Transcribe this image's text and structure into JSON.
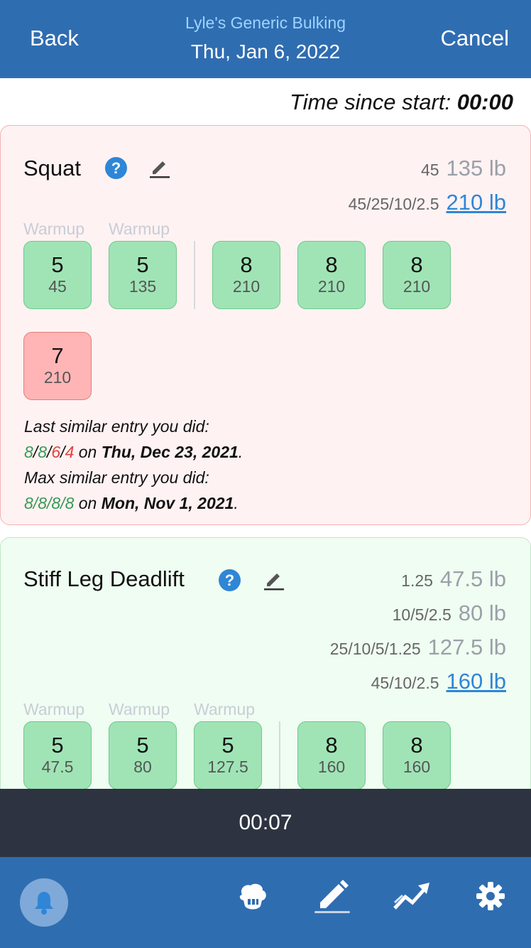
{
  "header": {
    "back_label": "Back",
    "cancel_label": "Cancel",
    "program_name": "Lyle's Generic Bulking",
    "date": "Thu, Jan 6, 2022"
  },
  "timer": {
    "label": "Time since start:",
    "value": "00:00"
  },
  "exercises": [
    {
      "name": "Squat",
      "plates": [
        {
          "plates": "45",
          "weight": "135 lb",
          "is_link": false
        },
        {
          "plates": "45/25/10/2.5",
          "weight": "210 lb",
          "is_link": true
        }
      ],
      "warmup_label": "Warmup",
      "warmup_sets": [
        {
          "reps": "5",
          "weight": "45"
        },
        {
          "reps": "5",
          "weight": "135"
        }
      ],
      "work_sets": [
        {
          "reps": "8",
          "weight": "210",
          "status": "success"
        },
        {
          "reps": "8",
          "weight": "210",
          "status": "success"
        },
        {
          "reps": "8",
          "weight": "210",
          "status": "success"
        },
        {
          "reps": "7",
          "weight": "210",
          "status": "fail"
        }
      ],
      "history": {
        "last_label": "Last similar entry you did:",
        "last_reps": [
          "8",
          "8",
          "6",
          "4"
        ],
        "last_reps_status": [
          "success",
          "success",
          "fail",
          "fail"
        ],
        "last_on": "on",
        "last_date": "Thu, Dec 23, 2021",
        "max_label": "Max similar entry you did:",
        "max_reps": [
          "8",
          "8",
          "8",
          "8"
        ],
        "max_on": "on",
        "max_date": "Mon, Nov 1, 2021",
        "separator": "/",
        "period": "."
      }
    },
    {
      "name": "Stiff Leg Deadlift",
      "plates": [
        {
          "plates": "1.25",
          "weight": "47.5 lb",
          "is_link": false
        },
        {
          "plates": "10/5/2.5",
          "weight": "80 lb",
          "is_link": false
        },
        {
          "plates": "25/10/5/1.25",
          "weight": "127.5 lb",
          "is_link": false
        },
        {
          "plates": "45/10/2.5",
          "weight": "160 lb",
          "is_link": true
        }
      ],
      "warmup_label": "Warmup",
      "warmup_sets": [
        {
          "reps": "5",
          "weight": "47.5"
        },
        {
          "reps": "5",
          "weight": "80"
        },
        {
          "reps": "5",
          "weight": "127.5"
        }
      ],
      "work_sets": [
        {
          "reps": "8",
          "weight": "160",
          "status": "success"
        },
        {
          "reps": "8",
          "weight": "160",
          "status": "success"
        }
      ]
    }
  ],
  "rest_timer": "00:07",
  "nav": {
    "icons": [
      "bell-icon",
      "muscle-icon",
      "edit-icon",
      "chart-icon",
      "gear-icon"
    ],
    "active": "edit-icon"
  },
  "colors": {
    "header_bg": "#2f6db1",
    "success_box": "#a0e4b6",
    "fail_box": "#ffb5b5",
    "link": "#2f86d6",
    "rest_bar": "#2d3340"
  }
}
